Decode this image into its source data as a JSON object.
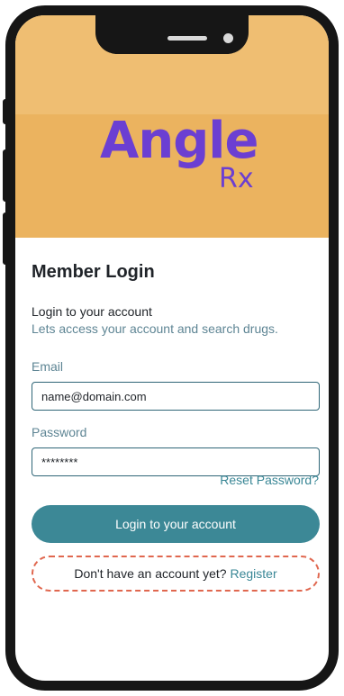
{
  "app": {
    "logo_word": "Angle",
    "logo_sub": "Rx",
    "brand_color": "#6b3fd2",
    "hero_color": "#ebb35f"
  },
  "login": {
    "title": "Member Login",
    "subtitle": "Login to your account",
    "tagline": "Lets access your account and search drugs.",
    "email_label": "Email",
    "email_value": "name@domain.com",
    "password_label": "Password",
    "password_value": "********",
    "reset_link": "Reset Password?",
    "submit_label": "Login to your account",
    "register_prompt": "Don't have an account yet?",
    "register_link": "Register",
    "accent_color": "#3c8896",
    "highlight_color": "#e0674f"
  }
}
